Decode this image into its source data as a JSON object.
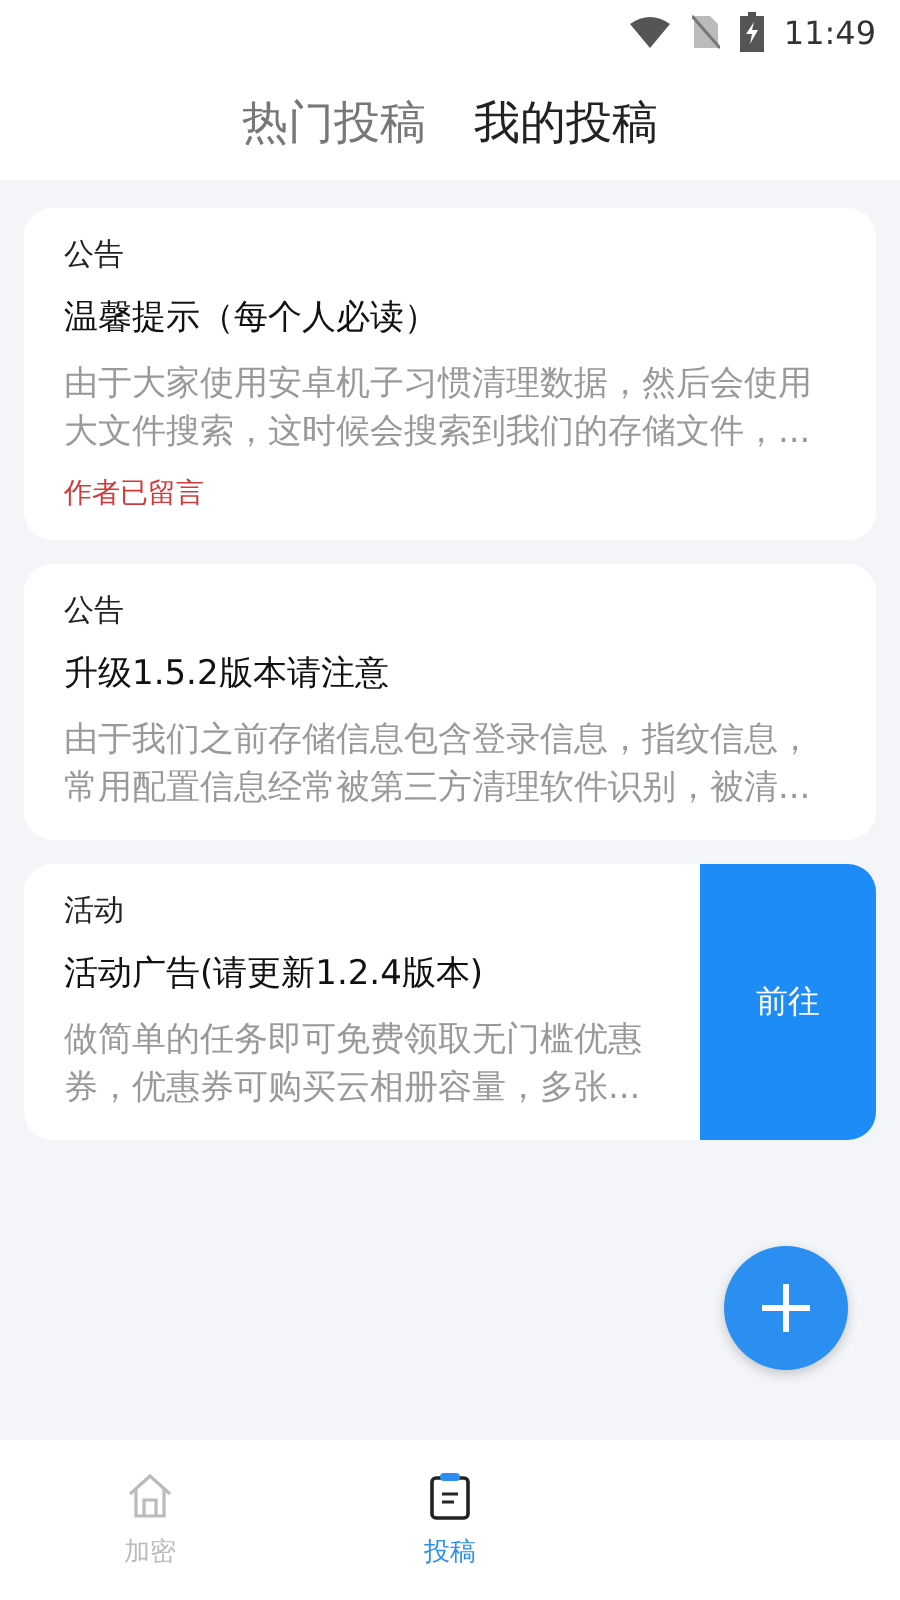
{
  "status_bar": {
    "time": "11:49"
  },
  "header_tabs": [
    {
      "label": "热门投稿",
      "selected": false
    },
    {
      "label": "我的投稿",
      "selected": true
    }
  ],
  "posts": [
    {
      "kind": "notice",
      "category": "公告",
      "title": "温馨提示（每个人必读）",
      "excerpt": "由于大家使用安卓机子习惯清理数据，然后会使用大文件搜索，这时候会搜索到我们的存储文件，...",
      "note": "作者已留言"
    },
    {
      "kind": "notice",
      "category": "公告",
      "title": "升级1.5.2版本请注意",
      "excerpt": "由于我们之前存储信息包含登录信息，指纹信息，常用配置信息经常被第三方清理软件识别，被清..."
    },
    {
      "kind": "activity",
      "category": "活动",
      "title": "活动广告(请更新1.2.4版本)",
      "excerpt": "做简单的任务即可免费领取无门槛优惠券，优惠券可购买云相册容量，多张...",
      "action": "前往"
    }
  ],
  "bottom_nav": [
    {
      "label": "加密",
      "kind": "home",
      "selected": false
    },
    {
      "label": "投稿",
      "kind": "clipboard",
      "selected": true
    }
  ]
}
